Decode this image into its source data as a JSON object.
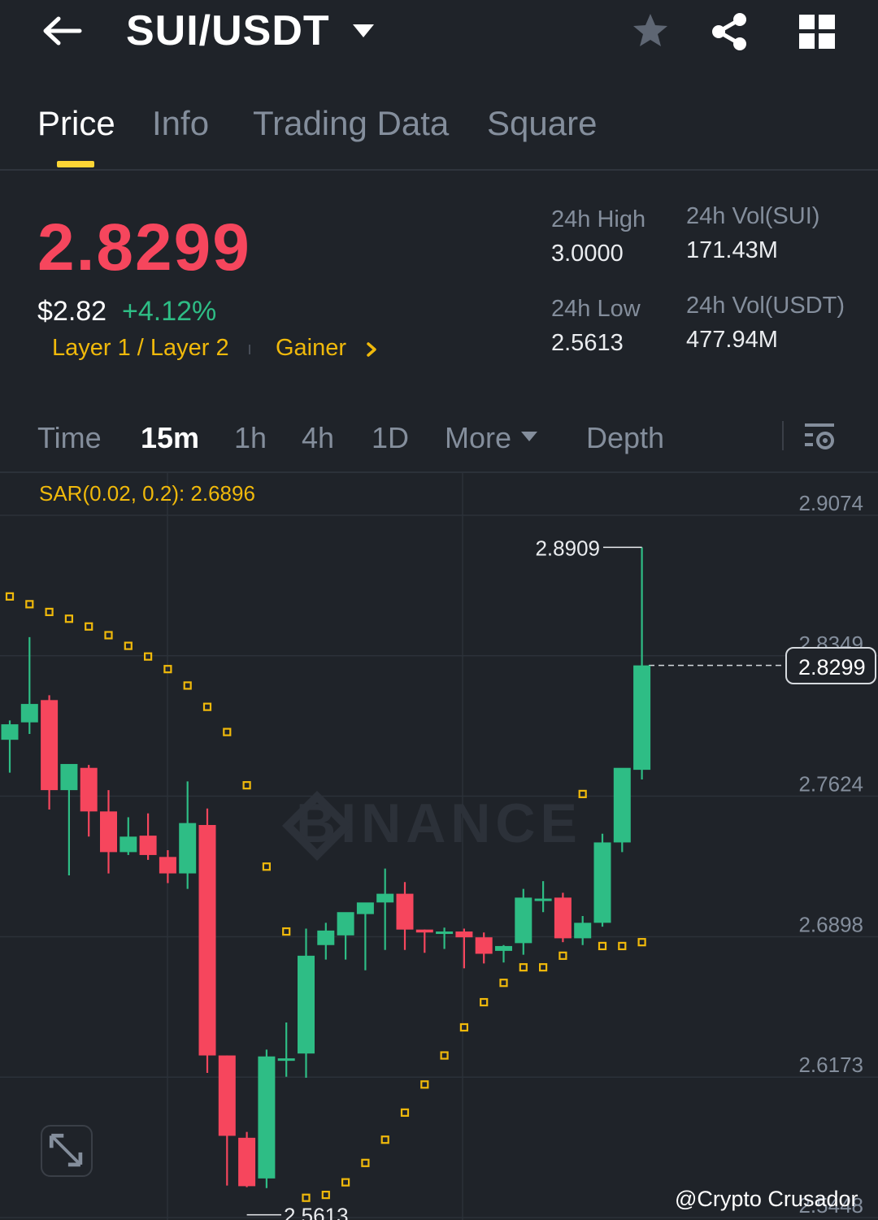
{
  "header": {
    "pair": "SUI/USDT",
    "icons": [
      "back-arrow-icon",
      "caret-down-icon",
      "star-icon",
      "share-icon",
      "grid-icon"
    ]
  },
  "tabs": [
    {
      "label": "Price",
      "active": true
    },
    {
      "label": "Info",
      "active": false
    },
    {
      "label": "Trading Data",
      "active": false
    },
    {
      "label": "Square",
      "active": false
    }
  ],
  "price": {
    "last": "2.8299",
    "usd": "$2.82",
    "change": "+4.12%",
    "tags": [
      "Layer 1 / Layer 2",
      "Gainer"
    ]
  },
  "stats": {
    "high_label": "24h High",
    "high": "3.0000",
    "low_label": "24h Low",
    "low": "2.5613",
    "vol_base_label": "24h Vol(SUI)",
    "vol_base": "171.43M",
    "vol_quote_label": "24h Vol(USDT)",
    "vol_quote": "477.94M"
  },
  "intervals": [
    {
      "label": "Time",
      "active": false
    },
    {
      "label": "15m",
      "active": true
    },
    {
      "label": "1h",
      "active": false
    },
    {
      "label": "4h",
      "active": false
    },
    {
      "label": "1D",
      "active": false
    },
    {
      "label": "More",
      "active": false
    },
    {
      "label": "Depth",
      "active": false
    }
  ],
  "colors": {
    "up": "#2ebd85",
    "down": "#f6465d",
    "accent": "#fcd535",
    "sar": "#f0b90b"
  },
  "chart_data": {
    "type": "candlestick",
    "indicator": "SAR(0.02, 0.2): 2.6896",
    "y_ticks": [
      "2.9074",
      "2.8349",
      "2.7624",
      "2.6898",
      "2.6173",
      "2.5448"
    ],
    "ylim": [
      2.5448,
      2.9074
    ],
    "current_price": "2.8299",
    "max_label": "2.8909",
    "min_label": "2.5613",
    "watermark_text": "BINANCE",
    "candles": [
      {
        "o": 2.7915,
        "h": 2.8015,
        "c": 2.7995,
        "l": 2.7745
      },
      {
        "o": 2.8005,
        "h": 2.8445,
        "c": 2.81,
        "l": 2.7945
      },
      {
        "o": 2.812,
        "h": 2.8145,
        "c": 2.7655,
        "l": 2.7555
      },
      {
        "o": 2.7655,
        "h": 2.7775,
        "c": 2.779,
        "l": 2.7215
      },
      {
        "o": 2.777,
        "h": 2.7785,
        "c": 2.7545,
        "l": 2.7415
      },
      {
        "o": 2.7545,
        "h": 2.7655,
        "c": 2.7335,
        "l": 2.7225
      },
      {
        "o": 2.7335,
        "h": 2.7515,
        "c": 2.7415,
        "l": 2.732
      },
      {
        "o": 2.742,
        "h": 2.7535,
        "c": 2.732,
        "l": 2.7295
      },
      {
        "o": 2.731,
        "h": 2.7345,
        "c": 2.7225,
        "l": 2.7175
      },
      {
        "o": 2.7225,
        "h": 2.77,
        "c": 2.7485,
        "l": 2.7145
      },
      {
        "o": 2.7475,
        "h": 2.756,
        "c": 2.6285,
        "l": 2.6195
      },
      {
        "o": 2.6285,
        "h": 2.6285,
        "c": 2.587,
        "l": 2.5613
      },
      {
        "o": 2.586,
        "h": 2.589,
        "c": 2.561,
        "l": 2.5605
      },
      {
        "o": 2.565,
        "h": 2.6315,
        "c": 2.628,
        "l": 2.56
      },
      {
        "o": 2.627,
        "h": 2.6455,
        "c": 2.627,
        "l": 2.6175
      },
      {
        "o": 2.6295,
        "h": 2.694,
        "c": 2.68,
        "l": 2.617
      },
      {
        "o": 2.6855,
        "h": 2.697,
        "c": 2.693,
        "l": 2.678
      },
      {
        "o": 2.6905,
        "h": 2.701,
        "c": 2.7025,
        "l": 2.678
      },
      {
        "o": 2.7015,
        "h": 2.7055,
        "c": 2.7075,
        "l": 2.6725
      },
      {
        "o": 2.7075,
        "h": 2.725,
        "c": 2.712,
        "l": 2.683
      },
      {
        "o": 2.712,
        "h": 2.718,
        "c": 2.6935,
        "l": 2.683
      },
      {
        "o": 2.6935,
        "h": 2.6935,
        "c": 2.692,
        "l": 2.6815
      },
      {
        "o": 2.692,
        "h": 2.6945,
        "c": 2.6925,
        "l": 2.6835
      },
      {
        "o": 2.6925,
        "h": 2.694,
        "c": 2.6895,
        "l": 2.6735
      },
      {
        "o": 2.6895,
        "h": 2.692,
        "c": 2.681,
        "l": 2.676
      },
      {
        "o": 2.6825,
        "h": 2.6855,
        "c": 2.685,
        "l": 2.6765
      },
      {
        "o": 2.6865,
        "h": 2.7145,
        "c": 2.71,
        "l": 2.6805
      },
      {
        "o": 2.7085,
        "h": 2.7185,
        "c": 2.7095,
        "l": 2.7025
      },
      {
        "o": 2.71,
        "h": 2.7125,
        "c": 2.689,
        "l": 2.687
      },
      {
        "o": 2.689,
        "h": 2.7005,
        "c": 2.697,
        "l": 2.6855
      },
      {
        "o": 2.697,
        "h": 2.743,
        "c": 2.7385,
        "l": 2.695
      },
      {
        "o": 2.7385,
        "h": 2.7535,
        "c": 2.777,
        "l": 2.7335
      },
      {
        "o": 2.776,
        "h": 2.8909,
        "c": 2.8299,
        "l": 2.771
      }
    ],
    "sar": [
      {
        "i": 0,
        "v": 2.8655
      },
      {
        "i": 1,
        "v": 2.8615
      },
      {
        "i": 2,
        "v": 2.8575
      },
      {
        "i": 3,
        "v": 2.854
      },
      {
        "i": 4,
        "v": 2.85
      },
      {
        "i": 5,
        "v": 2.8455
      },
      {
        "i": 6,
        "v": 2.84
      },
      {
        "i": 7,
        "v": 2.8345
      },
      {
        "i": 8,
        "v": 2.828
      },
      {
        "i": 9,
        "v": 2.8195
      },
      {
        "i": 10,
        "v": 2.8085
      },
      {
        "i": 11,
        "v": 2.7955
      },
      {
        "i": 12,
        "v": 2.768
      },
      {
        "i": 13,
        "v": 2.726
      },
      {
        "i": 14,
        "v": 2.6925
      },
      {
        "i": 15,
        "v": 2.555
      },
      {
        "i": 16,
        "v": 2.5565
      },
      {
        "i": 17,
        "v": 2.563
      },
      {
        "i": 18,
        "v": 2.573
      },
      {
        "i": 19,
        "v": 2.585
      },
      {
        "i": 20,
        "v": 2.599
      },
      {
        "i": 21,
        "v": 2.6135
      },
      {
        "i": 22,
        "v": 2.6285
      },
      {
        "i": 23,
        "v": 2.643
      },
      {
        "i": 24,
        "v": 2.656
      },
      {
        "i": 25,
        "v": 2.666
      },
      {
        "i": 26,
        "v": 2.674
      },
      {
        "i": 27,
        "v": 2.674
      },
      {
        "i": 28,
        "v": 2.68
      },
      {
        "i": 29,
        "v": 2.7635
      },
      {
        "i": 30,
        "v": 2.685
      },
      {
        "i": 31,
        "v": 2.685
      },
      {
        "i": 32,
        "v": 2.687
      }
    ]
  },
  "watermark": "@Crypto Crusador"
}
